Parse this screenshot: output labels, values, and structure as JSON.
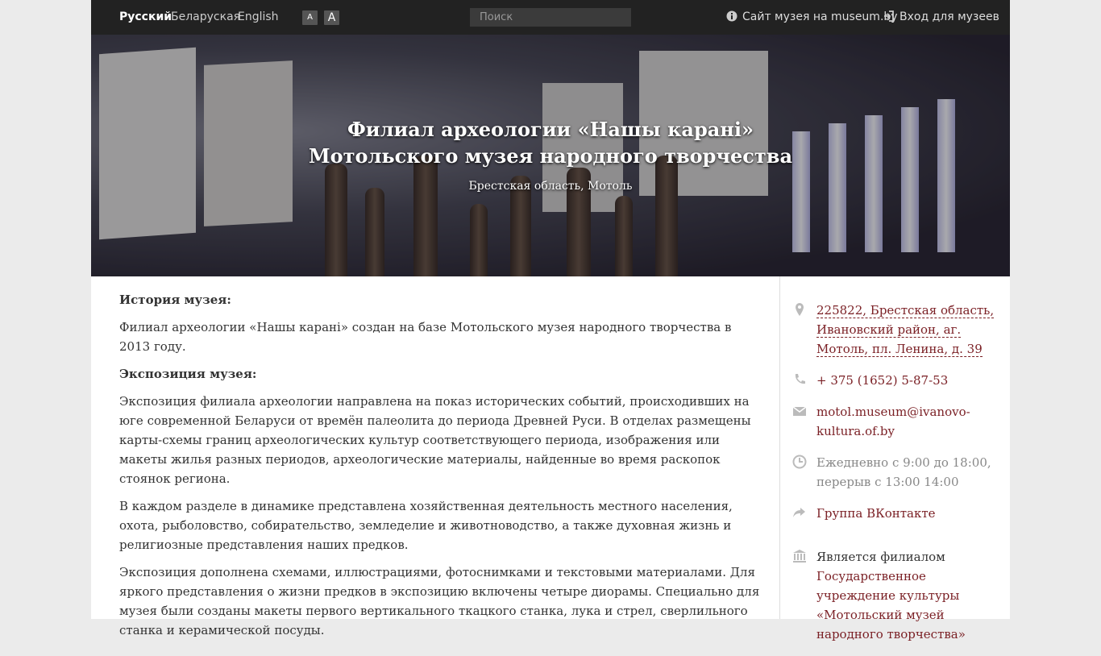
{
  "topbar": {
    "languages": [
      "Русский",
      "Беларуская",
      "English"
    ],
    "font_small": "A",
    "font_large": "A",
    "search_placeholder": "Поиск",
    "museum_site_link": "Сайт музея на museum.by",
    "login_link": "Вход для музеев"
  },
  "hero": {
    "title": "Филиал археологии «Нашы каранi» Мотольского музея народного творчества",
    "location": "Брестская область, Мотоль"
  },
  "content": {
    "history_heading": "История музея:",
    "history_text": "Филиал археологии «Нашы каранi» создан на базе Мотольского музея народного творчества в 2013 году.",
    "exposition_heading": "Экспозиция музея:",
    "paragraphs": [
      "Экспозиция филиала археологии направлена на показ исторических событий, происходивших на юге современной Беларуси от времён палеолита до периода Древней Руси. В отделах размещены карты-схемы границ археологических культур соответствующего периода, изображения или макеты жилья разных периодов, археологические материалы, найденные во время раскопок стоянок региона.",
      "В каждом разделе в динамике представлена хозяйственная деятельность местного населения, охота, рыболовство, собирательство, земледелие и животноводство, а также духовная жизнь и религиозные представления наших предков.",
      "Экспозиция дополнена схемами, иллюстрациями, фотоснимками и текстовыми материалами. Для яркого представления о жизни предков в экспозицию включены четыре диорамы. Специально для музея были созданы макеты первого вертикального ткацкого станка, лука и стрел, сверлильного станка и керамической посуды."
    ]
  },
  "sidebar": {
    "address": "225822, Брестская область, Ивановский район, аг. Мотоль, пл. Ленина, д. 39",
    "phone": "+ 375 (1652) 5-87-53",
    "email": "motol.museum@ivanovo-kultura.of.by",
    "hours": "Ежедневно с 9:00 до 18:00, перерыв с 13:00 14:00",
    "social": "Группа ВКонтакте",
    "branch_label": "Является филиалом",
    "branch_parent": "Государственное учреждение культуры «Мотольский музей народного творчества»"
  },
  "colors": {
    "topbar_bg": "#222222",
    "link": "#7a1f24",
    "text": "#333333",
    "muted": "#888888"
  },
  "icons": [
    "info-icon",
    "login-icon",
    "map-marker-icon",
    "phone-icon",
    "envelope-icon",
    "clock-icon",
    "share-icon",
    "bank-icon"
  ]
}
